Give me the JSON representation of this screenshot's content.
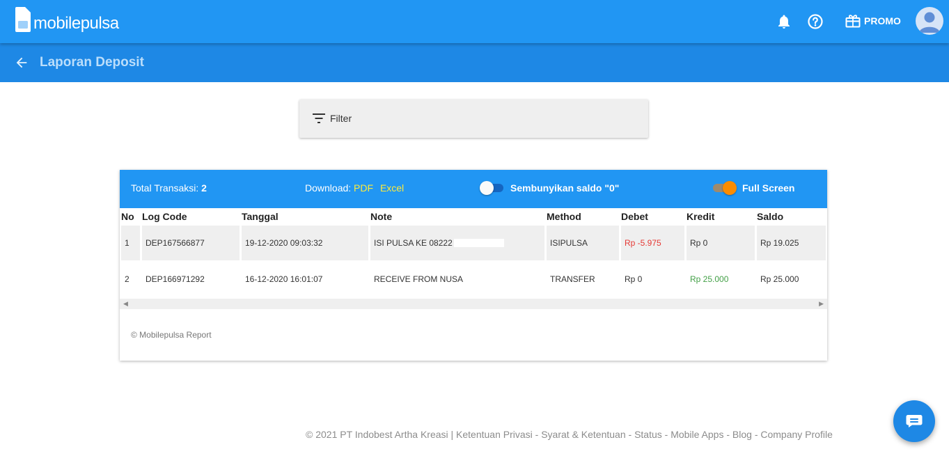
{
  "brand": {
    "name": "mobilepulsa"
  },
  "topbar": {
    "promo_label": "PROMO",
    "icons": [
      "bell-icon",
      "help-icon",
      "gift-icon",
      "avatar"
    ]
  },
  "subheader": {
    "title": "Laporan Deposit",
    "back_icon": "arrow-left-icon"
  },
  "filter": {
    "label": "Filter",
    "icon": "filter-list-icon"
  },
  "report": {
    "total_label": "Total Transaksi:",
    "total_value": "2",
    "download_label": "Download:",
    "pdf_label": "PDF",
    "excel_label": "Excel",
    "hide_zero_label": "Sembunyikan saldo \"0\"",
    "hide_zero_on": false,
    "fullscreen_label": "Full Screen",
    "fullscreen_on": true,
    "columns": [
      "No",
      "Log Code",
      "Tanggal",
      "Note",
      "Method",
      "Debet",
      "Kredit",
      "Saldo"
    ],
    "rows": [
      {
        "no": "1",
        "log_code": "DEP167566877",
        "tanggal": "19-12-2020 09:03:32",
        "note": "ISI PULSA KE 08222",
        "method": "ISIPULSA",
        "debet": "Rp -5.975",
        "kredit": "Rp 0",
        "saldo": "Rp 19.025"
      },
      {
        "no": "2",
        "log_code": "DEP166971292",
        "tanggal": "16-12-2020 16:01:07",
        "note": "RECEIVE FROM NUSA",
        "method": "TRANSFER",
        "debet": "Rp 0",
        "kredit": "Rp 25.000",
        "saldo": "Rp 25.000"
      }
    ],
    "footer_text": "© Mobilepulsa Report"
  },
  "footer": {
    "text": "© 2021 PT Indobest Artha Kreasi | Ketentuan Privasi - Syarat & Ketentuan - Status - Mobile Apps - Blog - Company Profile"
  },
  "colors": {
    "primary": "#2196f3",
    "primary_dark": "#1e88e5",
    "link_yellow": "#ffeb3b",
    "negative": "#e53935",
    "positive": "#43a047",
    "toggle_on": "#fb8c00"
  }
}
